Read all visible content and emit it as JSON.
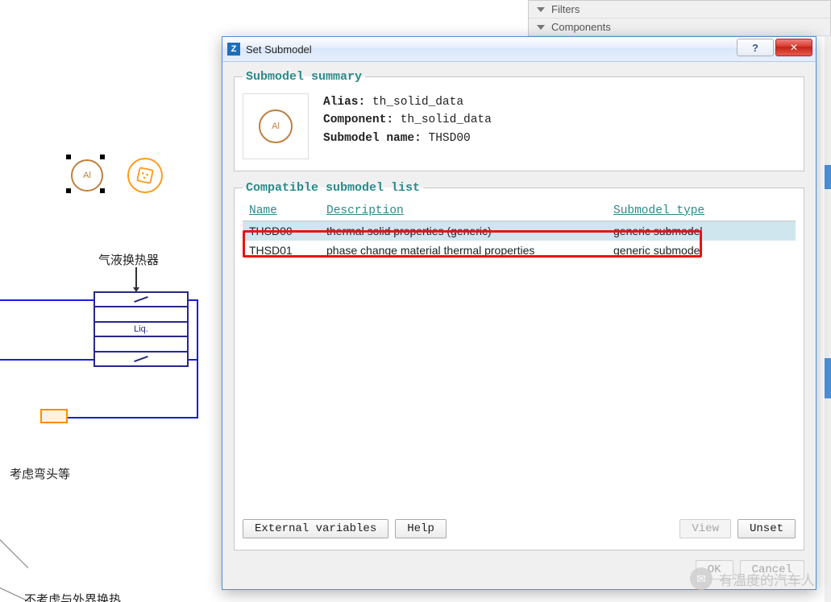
{
  "bg": {
    "filters_label": "Filters",
    "components_label": "Components"
  },
  "canvas": {
    "al_label": "Al",
    "hx_label": "气液换热器",
    "liq_label": "Liq.",
    "bends_label": "考虑弯头等",
    "truncated_label": "不考虑与外界换热"
  },
  "dialog": {
    "title": "Set Submodel",
    "summary": {
      "legend": "Submodel summary",
      "alias_label": "Alias:",
      "alias_value": "th_solid_data",
      "component_label": "Component:",
      "component_value": "th_solid_data",
      "name_label": "Submodel name:",
      "name_value": "THSD00",
      "icon_text": "Al"
    },
    "list": {
      "legend": "Compatible submodel list",
      "headers": {
        "name": "Name",
        "desc": "Description",
        "type": "Submodel type"
      },
      "rows": [
        {
          "name": "THSD00",
          "desc": "thermal solid properties (generic)",
          "type": "generic submodel",
          "selected": true
        },
        {
          "name": "THSD01",
          "desc": "phase change material thermal properties",
          "type": "generic submodel",
          "selected": false
        }
      ],
      "external_btn": "External variables",
      "help_btn": "Help",
      "view_btn": "View",
      "unset_btn": "Unset"
    },
    "footer": {
      "ok": "OK",
      "cancel": "Cancel"
    }
  },
  "watermark": {
    "text": "有温度的汽车人"
  }
}
